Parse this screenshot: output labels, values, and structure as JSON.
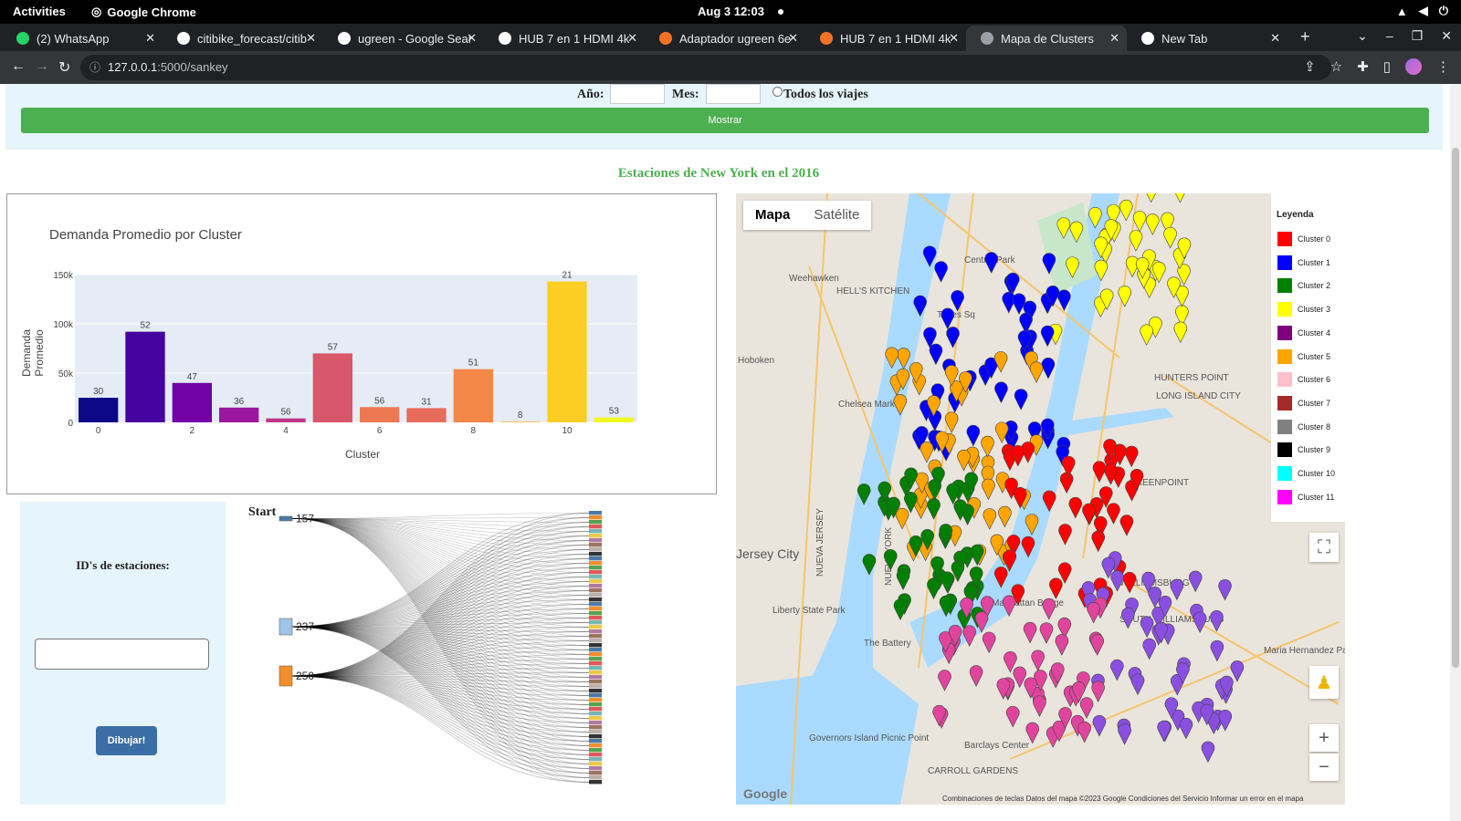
{
  "system_bar": {
    "activities": "Activities",
    "app_name": "Google Chrome",
    "clock": "Aug 3  12:03"
  },
  "tabs": [
    {
      "title": "(2) WhatsApp",
      "icon": "whatsapp-icon",
      "color": "#25d366",
      "active": false
    },
    {
      "title": "citibike_forecast/citib",
      "icon": "github-icon",
      "color": "#ffffff",
      "active": false
    },
    {
      "title": "ugreen - Google Sear",
      "icon": "google-icon",
      "color": "#ffffff",
      "active": false
    },
    {
      "title": "HUB 7 en 1 HDMI 4k",
      "icon": "google-icon",
      "color": "#ffffff",
      "active": false
    },
    {
      "title": "Adaptador ugreen 6e",
      "icon": "store-icon",
      "color": "#f57224",
      "active": false
    },
    {
      "title": "HUB 7 en 1 HDMI 4k",
      "icon": "store-icon",
      "color": "#f57224",
      "active": false
    },
    {
      "title": "Mapa de Clusters",
      "icon": "globe-icon",
      "color": "#9aa0a6",
      "active": true
    },
    {
      "title": "New Tab",
      "icon": "chrome-icon",
      "color": "#ffffff",
      "active": false
    }
  ],
  "address_bar": {
    "host": "127.0.0.1",
    "path": ":5000/sankey"
  },
  "form": {
    "year_label": "Año:",
    "year_value": "",
    "month_label": "Mes:",
    "month_value": "",
    "all_trips_label": "Todos los viajes",
    "show_button": "Mostrar"
  },
  "heading": "Estaciones de New York en el 2016",
  "chart_data": {
    "type": "bar",
    "title": "Demanda Promedio por Cluster",
    "xlabel": "Cluster",
    "ylabel": "Demanda Promedio",
    "ylim": [
      0,
      150000
    ],
    "yticks": [
      "0",
      "50k",
      "100k",
      "150k"
    ],
    "xticks": [
      "0",
      "2",
      "4",
      "6",
      "8",
      "10"
    ],
    "categories": [
      "0",
      "1",
      "2",
      "3",
      "4",
      "5",
      "6",
      "7",
      "8",
      "9",
      "10",
      "11"
    ],
    "values": [
      25000,
      92000,
      40000,
      15000,
      4000,
      70000,
      15500,
      14500,
      54000,
      700,
      143000,
      5000
    ],
    "labels": [
      "30",
      "52",
      "47",
      "36",
      "56",
      "57",
      "56",
      "31",
      "51",
      "8",
      "21",
      "53"
    ],
    "colors": [
      "#0d0887",
      "#46039f",
      "#7201a8",
      "#9c179e",
      "#bd3786",
      "#d8576b",
      "#ed7953",
      "#e66c5c",
      "#f48849",
      "#fdb42f",
      "#fcce25",
      "#f0f921"
    ]
  },
  "station_panel": {
    "label": "ID's de estaciones:",
    "input_value": "",
    "draw_button": "Dibujar!"
  },
  "sankey": {
    "start_label": "Start",
    "sources": [
      "157",
      "237",
      "250"
    ]
  },
  "map": {
    "type_map": "Mapa",
    "type_satellite": "Satélite",
    "legend_title": "Leyenda",
    "legend": [
      {
        "label": "Cluster 0",
        "color": "#ff0000"
      },
      {
        "label": "Cluster 1",
        "color": "#0000ff"
      },
      {
        "label": "Cluster 2",
        "color": "#008000"
      },
      {
        "label": "Cluster 3",
        "color": "#ffff00"
      },
      {
        "label": "Cluster 4",
        "color": "#800080"
      },
      {
        "label": "Cluster 5",
        "color": "#ffa500"
      },
      {
        "label": "Cluster 6",
        "color": "#ffc0cb"
      },
      {
        "label": "Cluster 7",
        "color": "#a52a2a"
      },
      {
        "label": "Cluster 8",
        "color": "#808080"
      },
      {
        "label": "Cluster 9",
        "color": "#000000"
      },
      {
        "label": "Cluster 10",
        "color": "#00ffff"
      },
      {
        "label": "Cluster 11",
        "color": "#ff00ff"
      }
    ],
    "places": [
      "Weehawken",
      "Hoboken",
      "Chelsea Market",
      "HELL'S KITCHEN",
      "Times Sq",
      "Central Park",
      "HUNTERS POINT",
      "LONG ISLAND CITY",
      "GREENPOINT",
      "WILLIAMSBURG",
      "SOUTH WILLIAMSBURG",
      "Manhattan Bridge",
      "Liberty State Park",
      "Governors Island Picnic Point",
      "Barclays Center",
      "CARROLL GARDENS",
      "Jersey City",
      "NUEVA JERSEY",
      "NUEVA YORK",
      "The Battery",
      "Maria Hernandez Park"
    ],
    "footer": "Combinaciones de teclas   Datos del mapa ©2023 Google   Condiciones del Servicio   Informar un error en el mapa",
    "google": "Google"
  }
}
